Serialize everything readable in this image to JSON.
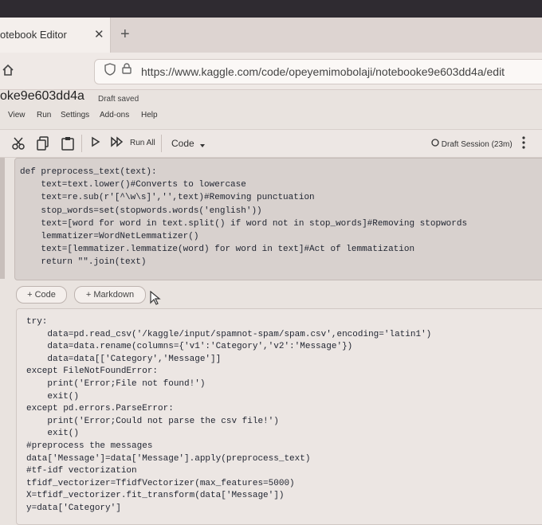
{
  "browser": {
    "tab_title": "otebook Editor",
    "tab_close": "✕",
    "new_tab": "+",
    "url": "https://www.kaggle.com/code/opeyemimobolaji/notebooke9e603dd4a/edit"
  },
  "notebook": {
    "title": "oke9e603dd4a",
    "status": "Draft saved"
  },
  "menu": [
    "View",
    "Run",
    "Settings",
    "Add-ons",
    "Help"
  ],
  "toolbar": {
    "run_all": "Run All",
    "cell_type": "Code",
    "session": "Draft Session (23m)"
  },
  "cell1": [
    "def preprocess_text(text):",
    "    text=text.lower()#Converts to lowercase",
    "    text=re.sub(r'[^\\w\\s]','',text)#Removing punctuation",
    "    stop_words=set(stopwords.words('english'))",
    "    text=[word for word in text.split() if word not in stop_words]#Removing stopwords",
    "    lemmatizer=WordNetLemmatizer()",
    "    text=[lemmatizer.lemmatize(word) for word in text]#Act of lemmatization",
    "    return \"\".join(text)"
  ],
  "add_buttons": {
    "code": "+ Code",
    "markdown": "+ Markdown"
  },
  "cell2": [
    "try:",
    "    data=pd.read_csv('/kaggle/input/spamnot-spam/spam.csv',encoding='latin1')",
    "    data=data.rename(columns={'v1':'Category','v2':'Message'})",
    "    data=data[['Category','Message']]",
    "except FileNotFoundError:",
    "    print('Error;File not found!')",
    "    exit()",
    "except pd.errors.ParseError:",
    "    print('Error;Could not parse the csv file!')",
    "    exit()",
    "#preprocess the messages",
    "data['Message']=data['Message'].apply(preprocess_text)",
    "#tf-idf vectorization",
    "tfidf_vectorizer=TfidfVectorizer(max_features=5000)",
    "X=tfidf_vectorizer.fit_transform(data['Message'])",
    "y=data['Category']"
  ]
}
